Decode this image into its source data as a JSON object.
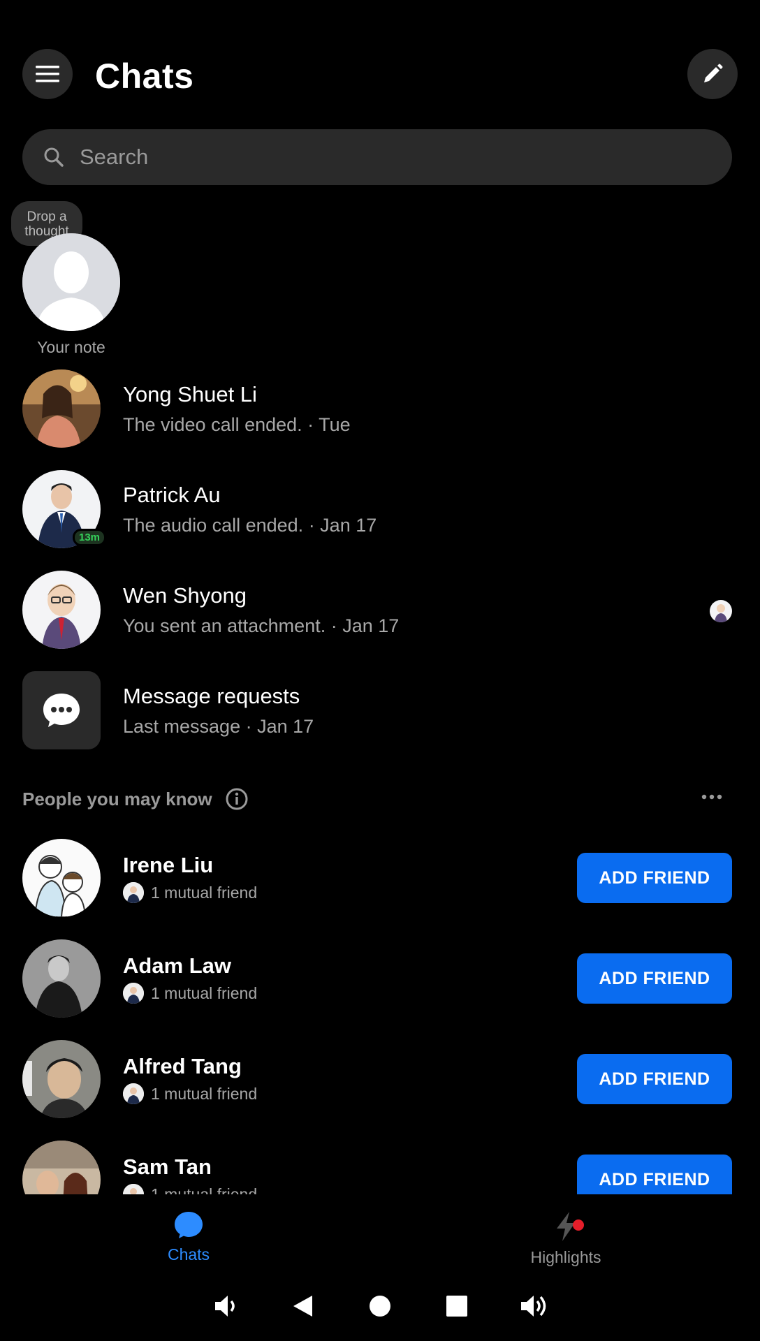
{
  "header": {
    "title": "Chats"
  },
  "search": {
    "placeholder": "Search"
  },
  "note": {
    "bubble_text": "Drop a thought",
    "label": "Your note"
  },
  "chats": [
    {
      "name": "Yong Shuet Li",
      "subtitle": "The video call ended. · Tue"
    },
    {
      "name": "Patrick Au",
      "subtitle": "The audio call ended. · Jan 17",
      "active_badge": "13m"
    },
    {
      "name": "Wen Shyong",
      "subtitle": "You sent an attachment. · Jan 17"
    },
    {
      "name": "Message requests",
      "subtitle": "Last message · Jan 17"
    }
  ],
  "people_section": {
    "title": "People you may know"
  },
  "suggestions": [
    {
      "name": "Irene Liu",
      "mutual": "1 mutual friend",
      "button": "ADD FRIEND"
    },
    {
      "name": "Adam Law",
      "mutual": "1 mutual friend",
      "button": "ADD FRIEND"
    },
    {
      "name": "Alfred Tang",
      "mutual": "1 mutual friend",
      "button": "ADD FRIEND"
    },
    {
      "name": "Sam Tan",
      "mutual": "1 mutual friend",
      "button": "ADD FRIEND"
    }
  ],
  "bottom_nav": {
    "chats_label": "Chats",
    "highlights_label": "Highlights"
  },
  "colors": {
    "accent": "#0a6cf0",
    "active_nav": "#2d8cff",
    "badge_green": "#35d15a",
    "notification": "#e41e2a"
  },
  "icons": [
    "menu-icon",
    "compose-icon",
    "search-icon",
    "chat-bubble-icon",
    "info-icon",
    "more-icon",
    "lightning-icon",
    "volume-down-icon",
    "back-icon",
    "home-icon",
    "recents-icon",
    "volume-up-icon"
  ]
}
